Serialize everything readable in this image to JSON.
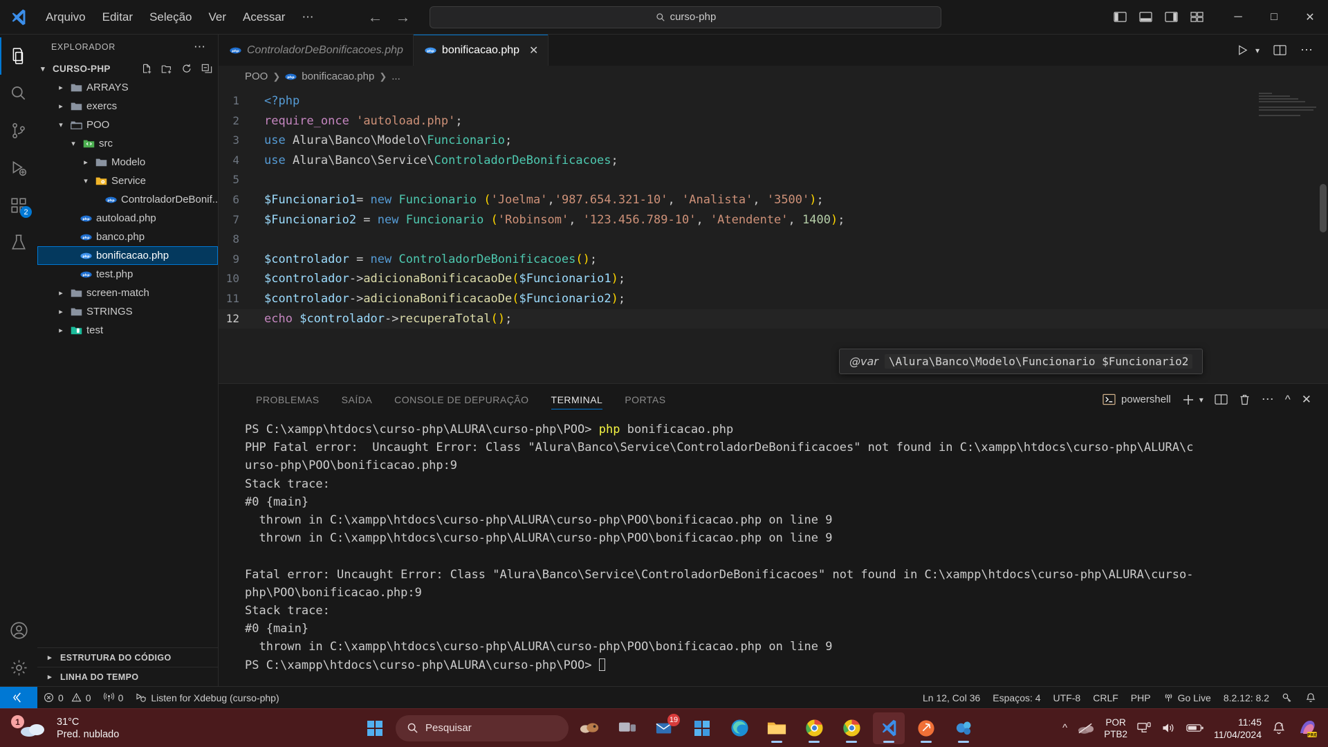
{
  "titlebar": {
    "logo_icon": "vscode-logo-icon",
    "menus": [
      "Arquivo",
      "Editar",
      "Seleção",
      "Ver",
      "Acessar",
      "⋯"
    ],
    "back_icon": "arrow-left-icon",
    "forward_icon": "arrow-right-icon",
    "search": {
      "icon": "search-icon",
      "value": "curso-php"
    },
    "layout_icons": [
      "toggle-primary-sidebar-icon",
      "toggle-panel-icon",
      "toggle-secondary-sidebar-icon",
      "customize-layout-icon"
    ],
    "window_buttons": {
      "minimize": "─",
      "maximize": "□",
      "close": "✕"
    }
  },
  "activitybar": {
    "items": [
      {
        "name": "explorer",
        "icon": "files-icon",
        "active": true,
        "badge": ""
      },
      {
        "name": "search",
        "icon": "search-icon",
        "active": false,
        "badge": ""
      },
      {
        "name": "source-control",
        "icon": "source-control-icon",
        "active": false,
        "badge": ""
      },
      {
        "name": "run-and-debug",
        "icon": "debug-icon",
        "active": false,
        "badge": ""
      },
      {
        "name": "extensions",
        "icon": "extensions-icon",
        "active": false,
        "badge": "2"
      },
      {
        "name": "testing",
        "icon": "beaker-icon",
        "active": false,
        "badge": ""
      }
    ],
    "bottom": [
      {
        "name": "accounts",
        "icon": "account-icon"
      },
      {
        "name": "manage",
        "icon": "gear-icon"
      }
    ]
  },
  "sidebar": {
    "title": "EXPLORADOR",
    "more_icon": "ellipsis-icon",
    "root": {
      "label": "CURSO-PHP",
      "expanded": true,
      "actions": [
        "new-file-icon",
        "new-folder-icon",
        "refresh-icon",
        "collapse-all-icon"
      ]
    },
    "tree": [
      {
        "label": "ARRAYS",
        "type": "folder",
        "indent": 1,
        "expanded": false,
        "selected": false
      },
      {
        "label": "exercs",
        "type": "folder",
        "indent": 1,
        "expanded": false,
        "selected": false
      },
      {
        "label": "POO",
        "type": "folder-open",
        "indent": 1,
        "expanded": true,
        "selected": false
      },
      {
        "label": "src",
        "type": "folder-src",
        "indent": 2,
        "expanded": true,
        "selected": false
      },
      {
        "label": "Modelo",
        "type": "folder",
        "indent": 3,
        "expanded": false,
        "selected": false
      },
      {
        "label": "Service",
        "type": "folder-service",
        "indent": 3,
        "expanded": true,
        "selected": false
      },
      {
        "label": "ControladorDeBonif...",
        "type": "php",
        "indent": 4,
        "expanded": null,
        "selected": false
      },
      {
        "label": "autoload.php",
        "type": "php",
        "indent": 3,
        "expanded": null,
        "selected": false
      },
      {
        "label": "banco.php",
        "type": "php",
        "indent": 3,
        "expanded": null,
        "selected": false
      },
      {
        "label": "bonificacao.php",
        "type": "php",
        "indent": 3,
        "expanded": null,
        "selected": true
      },
      {
        "label": "test.php",
        "type": "php",
        "indent": 3,
        "expanded": null,
        "selected": false
      },
      {
        "label": "screen-match",
        "type": "folder",
        "indent": 1,
        "expanded": false,
        "selected": false
      },
      {
        "label": "STRINGS",
        "type": "folder",
        "indent": 1,
        "expanded": false,
        "selected": false
      },
      {
        "label": "test",
        "type": "folder-test",
        "indent": 1,
        "expanded": false,
        "selected": false
      }
    ],
    "sections": [
      {
        "label": "ESTRUTURA DO CÓDIGO",
        "expanded": false
      },
      {
        "label": "LINHA DO TEMPO",
        "expanded": false
      }
    ]
  },
  "editor": {
    "tabs": [
      {
        "label": "ControladorDeBonificacoes.php",
        "icon": "php-icon",
        "active": false,
        "preview": true,
        "close": ""
      },
      {
        "label": "bonificacao.php",
        "icon": "php-icon",
        "active": true,
        "preview": false,
        "close": "✕"
      }
    ],
    "tab_actions": [
      "run-icon",
      "run-chevron-icon",
      "split-editor-icon",
      "more-actions-icon"
    ],
    "breadcrumb": [
      "POO",
      "bonificacao.php",
      "..."
    ],
    "breadcrumb_file_icon": "php-icon",
    "lines": [
      {
        "n": "1",
        "tokens": [
          {
            "t": "<?php",
            "c": "t-tag"
          }
        ]
      },
      {
        "n": "2",
        "tokens": [
          {
            "t": "require_once",
            "c": "t-kw"
          },
          {
            "t": " ",
            "c": "t-pl"
          },
          {
            "t": "'autoload.php'",
            "c": "t-str"
          },
          {
            "t": ";",
            "c": "t-pl"
          }
        ]
      },
      {
        "n": "3",
        "tokens": [
          {
            "t": "use",
            "c": "t-kw2"
          },
          {
            "t": " Alura\\Banco\\Modelo\\",
            "c": "t-pl"
          },
          {
            "t": "Funcionario",
            "c": "t-cls"
          },
          {
            "t": ";",
            "c": "t-pl"
          }
        ]
      },
      {
        "n": "4",
        "tokens": [
          {
            "t": "use",
            "c": "t-kw2"
          },
          {
            "t": " Alura\\Banco\\Service\\",
            "c": "t-pl"
          },
          {
            "t": "ControladorDeBonificacoes",
            "c": "t-cls"
          },
          {
            "t": ";",
            "c": "t-pl"
          }
        ]
      },
      {
        "n": "5",
        "tokens": []
      },
      {
        "n": "6",
        "tokens": [
          {
            "t": "$Funcionario1",
            "c": "t-var"
          },
          {
            "t": "= ",
            "c": "t-pl"
          },
          {
            "t": "new",
            "c": "t-kw2"
          },
          {
            "t": " ",
            "c": "t-pl"
          },
          {
            "t": "Funcionario",
            "c": "t-cls"
          },
          {
            "t": " ",
            "c": "t-pl"
          },
          {
            "t": "(",
            "c": "t-par"
          },
          {
            "t": "'Joelma'",
            "c": "t-str"
          },
          {
            "t": ",",
            "c": "t-pl"
          },
          {
            "t": "'987.654.321-10'",
            "c": "t-str"
          },
          {
            "t": ", ",
            "c": "t-pl"
          },
          {
            "t": "'Analista'",
            "c": "t-str"
          },
          {
            "t": ", ",
            "c": "t-pl"
          },
          {
            "t": "'3500'",
            "c": "t-str"
          },
          {
            "t": ")",
            "c": "t-par"
          },
          {
            "t": ";",
            "c": "t-pl"
          }
        ]
      },
      {
        "n": "7",
        "tokens": [
          {
            "t": "$Funcionario2",
            "c": "t-var"
          },
          {
            "t": " = ",
            "c": "t-pl"
          },
          {
            "t": "new",
            "c": "t-kw2"
          },
          {
            "t": " ",
            "c": "t-pl"
          },
          {
            "t": "Funcionario",
            "c": "t-cls"
          },
          {
            "t": " ",
            "c": "t-pl"
          },
          {
            "t": "(",
            "c": "t-par"
          },
          {
            "t": "'Robinsom'",
            "c": "t-str"
          },
          {
            "t": ", ",
            "c": "t-pl"
          },
          {
            "t": "'123.456.789-10'",
            "c": "t-str"
          },
          {
            "t": ", ",
            "c": "t-pl"
          },
          {
            "t": "'Atendente'",
            "c": "t-str"
          },
          {
            "t": ", ",
            "c": "t-pl"
          },
          {
            "t": "1400",
            "c": "t-num"
          },
          {
            "t": ")",
            "c": "t-par"
          },
          {
            "t": ";",
            "c": "t-pl"
          }
        ]
      },
      {
        "n": "8",
        "tokens": []
      },
      {
        "n": "9",
        "tokens": [
          {
            "t": "$controlador",
            "c": "t-var"
          },
          {
            "t": " = ",
            "c": "t-pl"
          },
          {
            "t": "new",
            "c": "t-kw2"
          },
          {
            "t": " ",
            "c": "t-pl"
          },
          {
            "t": "ControladorDeBonificacoes",
            "c": "t-cls"
          },
          {
            "t": "()",
            "c": "t-par"
          },
          {
            "t": ";",
            "c": "t-pl"
          }
        ]
      },
      {
        "n": "10",
        "tokens": [
          {
            "t": "$controlador",
            "c": "t-var"
          },
          {
            "t": "->",
            "c": "t-pl"
          },
          {
            "t": "adicionaBonificacaoDe",
            "c": "t-fn"
          },
          {
            "t": "(",
            "c": "t-par"
          },
          {
            "t": "$Funcionario1",
            "c": "t-var"
          },
          {
            "t": ")",
            "c": "t-par"
          },
          {
            "t": ";",
            "c": "t-pl"
          }
        ]
      },
      {
        "n": "11",
        "tokens": [
          {
            "t": "$controlador",
            "c": "t-var"
          },
          {
            "t": "->",
            "c": "t-pl"
          },
          {
            "t": "adicionaBonificacaoDe",
            "c": "t-fn"
          },
          {
            "t": "(",
            "c": "t-par"
          },
          {
            "t": "$Funcionario2",
            "c": "t-var"
          },
          {
            "t": ")",
            "c": "t-par"
          },
          {
            "t": ";",
            "c": "t-pl"
          }
        ]
      },
      {
        "n": "12",
        "tokens": [
          {
            "t": "echo",
            "c": "t-kw"
          },
          {
            "t": " ",
            "c": "t-pl"
          },
          {
            "t": "$controlador",
            "c": "t-var"
          },
          {
            "t": "->",
            "c": "t-pl"
          },
          {
            "t": "recuperaTotal",
            "c": "t-fn"
          },
          {
            "t": "()",
            "c": "t-par"
          },
          {
            "t": ";",
            "c": "t-pl"
          }
        ]
      }
    ],
    "current_line": "12",
    "tooltip": {
      "label": "@var",
      "type": "\\Alura\\Banco\\Modelo\\Funcionario $Funcionario2"
    }
  },
  "panel": {
    "tabs": [
      {
        "label": "PROBLEMAS",
        "active": false
      },
      {
        "label": "SAÍDA",
        "active": false
      },
      {
        "label": "CONSOLE DE DEPURAÇÃO",
        "active": false
      },
      {
        "label": "TERMINAL",
        "active": true
      },
      {
        "label": "PORTAS",
        "active": false
      }
    ],
    "shell": {
      "icon": "powershell-icon",
      "label": "powershell"
    },
    "actions": [
      "new-terminal-icon",
      "terminal-chevron-icon",
      "split-terminal-icon",
      "kill-terminal-icon",
      "more-actions-icon",
      "maximize-panel-icon",
      "close-panel-icon"
    ],
    "terminal_lines": [
      {
        "segments": [
          {
            "t": "PS C:\\xampp\\htdocs\\curso-php\\ALURA\\curso-php\\POO> ",
            "c": ""
          },
          {
            "t": "php",
            "c": "yellow"
          },
          {
            "t": " bonificacao.php",
            "c": ""
          }
        ]
      },
      {
        "segments": [
          {
            "t": "PHP Fatal error:  Uncaught Error: Class \"Alura\\Banco\\Service\\ControladorDeBonificacoes\" not found in C:\\xampp\\htdocs\\curso-php\\ALURA\\c",
            "c": ""
          }
        ]
      },
      {
        "segments": [
          {
            "t": "urso-php\\POO\\bonificacao.php:9",
            "c": ""
          }
        ]
      },
      {
        "segments": [
          {
            "t": "Stack trace:",
            "c": ""
          }
        ]
      },
      {
        "segments": [
          {
            "t": "#0 {main}",
            "c": ""
          }
        ]
      },
      {
        "segments": [
          {
            "t": "  thrown in C:\\xampp\\htdocs\\curso-php\\ALURA\\curso-php\\POO\\bonificacao.php on line 9",
            "c": ""
          }
        ]
      },
      {
        "segments": [
          {
            "t": "  thrown in C:\\xampp\\htdocs\\curso-php\\ALURA\\curso-php\\POO\\bonificacao.php on line 9",
            "c": ""
          }
        ]
      },
      {
        "segments": [
          {
            "t": "",
            "c": ""
          }
        ]
      },
      {
        "segments": [
          {
            "t": "Fatal error: Uncaught Error: Class \"Alura\\Banco\\Service\\ControladorDeBonificacoes\" not found in C:\\xampp\\htdocs\\curso-php\\ALURA\\curso-",
            "c": ""
          }
        ]
      },
      {
        "segments": [
          {
            "t": "php\\POO\\bonificacao.php:9",
            "c": ""
          }
        ]
      },
      {
        "segments": [
          {
            "t": "Stack trace:",
            "c": ""
          }
        ]
      },
      {
        "segments": [
          {
            "t": "#0 {main}",
            "c": ""
          }
        ]
      },
      {
        "segments": [
          {
            "t": "  thrown in C:\\xampp\\htdocs\\curso-php\\ALURA\\curso-php\\POO\\bonificacao.php on line 9",
            "c": ""
          }
        ]
      },
      {
        "segments": [
          {
            "t": "PS C:\\xampp\\htdocs\\curso-php\\ALURA\\curso-php\\POO> ",
            "c": ""
          }
        ]
      }
    ]
  },
  "statusbar": {
    "remote_icon": "remote-window-icon",
    "left": [
      {
        "name": "errors-warnings",
        "icon": "error-warning-icon",
        "label": "0  0"
      },
      {
        "name": "radio-tower",
        "icon": "radio-tower-icon",
        "label": "0"
      },
      {
        "name": "xdebug-listen",
        "icon": "debug-alt-icon",
        "label": "Listen for Xdebug (curso-php)"
      }
    ],
    "right": [
      {
        "name": "cursor-position",
        "label": "Ln 12, Col 36"
      },
      {
        "name": "indentation",
        "label": "Espaços: 4"
      },
      {
        "name": "encoding",
        "label": "UTF-8"
      },
      {
        "name": "eol",
        "label": "CRLF"
      },
      {
        "name": "language-mode",
        "label": "PHP"
      },
      {
        "name": "go-live",
        "icon": "broadcast-icon",
        "label": "Go Live"
      },
      {
        "name": "php-version",
        "label": "8.2.12: 8.2"
      },
      {
        "name": "intelliphense",
        "icon": "key-icon",
        "label": ""
      },
      {
        "name": "notifications",
        "icon": "bell-icon",
        "label": ""
      }
    ]
  },
  "taskbar": {
    "weather": {
      "temp": "31°C",
      "condition": "Pred. nublado",
      "badge": "1",
      "icon": "cloud-icon"
    },
    "start_icon": "windows-start-icon",
    "search": {
      "icon": "search-icon",
      "placeholder": "Pesquisar"
    },
    "apps": [
      {
        "name": "widgets-icon",
        "running": false,
        "active": false
      },
      {
        "name": "task-view-icon",
        "running": false,
        "active": false
      },
      {
        "name": "mail-icon",
        "running": false,
        "active": false,
        "badge": "19"
      },
      {
        "name": "microsoft-store-icon",
        "running": false,
        "active": false
      },
      {
        "name": "edge-icon",
        "running": false,
        "active": false
      },
      {
        "name": "file-explorer-icon",
        "running": true,
        "active": false
      },
      {
        "name": "chrome-icon",
        "running": true,
        "active": false
      },
      {
        "name": "chrome-2-icon",
        "running": true,
        "active": false
      },
      {
        "name": "vscode-icon",
        "running": true,
        "active": true
      },
      {
        "name": "postman-icon",
        "running": true,
        "active": false
      },
      {
        "name": "xampp-icon",
        "running": true,
        "active": false
      }
    ],
    "tray": {
      "chevron_icon": "chevron-up-icon",
      "onedrive_icon": "onedrive-paused-icon",
      "keyboard": {
        "line1": "POR",
        "line2": "PTB2"
      },
      "network_icon": "network-icon",
      "volume_icon": "volume-icon",
      "battery_icon": "battery-icon",
      "clock": {
        "time": "11:45",
        "date": "11/04/2024"
      },
      "notification_icon": "bell-dnd-icon",
      "copilot_icon": "copilot-pre-icon"
    }
  }
}
